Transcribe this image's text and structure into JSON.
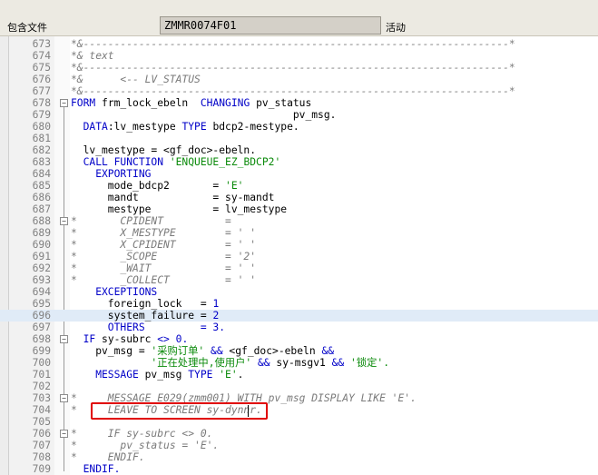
{
  "toolbar": {
    "include_label": "包含文件",
    "program_name": "ZMMR0074F01",
    "status": "活动"
  },
  "editor": {
    "current_line": 23,
    "lines": [
      {
        "n": "673",
        "fold": false,
        "parts": [
          [
            "cm",
            "*&---------------------------------------------------------------------*"
          ]
        ]
      },
      {
        "n": "674",
        "fold": false,
        "parts": [
          [
            "cm",
            "*& text"
          ]
        ]
      },
      {
        "n": "675",
        "fold": false,
        "parts": [
          [
            "cm",
            "*&---------------------------------------------------------------------*"
          ]
        ]
      },
      {
        "n": "676",
        "fold": false,
        "parts": [
          [
            "cm",
            "*&      <-- LV_STATUS"
          ]
        ]
      },
      {
        "n": "677",
        "fold": false,
        "parts": [
          [
            "cm",
            "*&---------------------------------------------------------------------*"
          ]
        ]
      },
      {
        "n": "678",
        "fold": true,
        "parts": [
          [
            "kw",
            "FORM "
          ],
          [
            "id",
            "frm_lock_ebeln  "
          ],
          [
            "kw",
            "CHANGING "
          ],
          [
            "id",
            "pv_status"
          ]
        ]
      },
      {
        "n": "679",
        "fold": false,
        "parts": [
          [
            "id",
            "                                    pv_msg."
          ]
        ]
      },
      {
        "n": "680",
        "fold": false,
        "parts": [
          [
            "kw",
            "  DATA"
          ],
          [
            "id",
            ":lv_mestype "
          ],
          [
            "kw",
            "TYPE "
          ],
          [
            "id",
            "bdcp2-mestype."
          ]
        ]
      },
      {
        "n": "681",
        "fold": false,
        "parts": [
          [
            "id",
            ""
          ]
        ]
      },
      {
        "n": "682",
        "fold": false,
        "parts": [
          [
            "id",
            "  lv_mestype = <gf_doc>-ebeln."
          ]
        ]
      },
      {
        "n": "683",
        "fold": false,
        "parts": [
          [
            "kw",
            "  CALL FUNCTION "
          ],
          [
            "st",
            "'ENQUEUE_EZ_BDCP2'"
          ]
        ]
      },
      {
        "n": "684",
        "fold": false,
        "parts": [
          [
            "kw",
            "    EXPORTING"
          ]
        ]
      },
      {
        "n": "685",
        "fold": false,
        "parts": [
          [
            "id",
            "      mode_bdcp2       = "
          ],
          [
            "st",
            "'E'"
          ]
        ]
      },
      {
        "n": "686",
        "fold": false,
        "parts": [
          [
            "id",
            "      mandt            = sy-mandt"
          ]
        ]
      },
      {
        "n": "687",
        "fold": false,
        "parts": [
          [
            "id",
            "      mestype          = lv_mestype"
          ]
        ]
      },
      {
        "n": "688",
        "fold": true,
        "parts": [
          [
            "cm",
            "*       CPIDENT          ="
          ]
        ]
      },
      {
        "n": "689",
        "fold": false,
        "parts": [
          [
            "cm",
            "*       X_MESTYPE        = ' '"
          ]
        ]
      },
      {
        "n": "690",
        "fold": false,
        "parts": [
          [
            "cm",
            "*       X_CPIDENT        = ' '"
          ]
        ]
      },
      {
        "n": "691",
        "fold": false,
        "parts": [
          [
            "cm",
            "*       _SCOPE           = '2'"
          ]
        ]
      },
      {
        "n": "692",
        "fold": false,
        "parts": [
          [
            "cm",
            "*       _WAIT            = ' '"
          ]
        ]
      },
      {
        "n": "693",
        "fold": false,
        "parts": [
          [
            "cm",
            "*       _COLLECT         = ' '"
          ]
        ]
      },
      {
        "n": "694",
        "fold": false,
        "parts": [
          [
            "kw",
            "    EXCEPTIONS"
          ]
        ]
      },
      {
        "n": "695",
        "fold": false,
        "parts": [
          [
            "id",
            "      foreign_lock   = "
          ],
          [
            "kw",
            "1"
          ]
        ]
      },
      {
        "n": "696",
        "fold": false,
        "parts": [
          [
            "id",
            "      system_failure = "
          ],
          [
            "kw",
            "2"
          ]
        ]
      },
      {
        "n": "697",
        "fold": false,
        "parts": [
          [
            "kw",
            "      OTHERS         = 3."
          ]
        ]
      },
      {
        "n": "698",
        "fold": true,
        "parts": [
          [
            "kw",
            "  IF "
          ],
          [
            "id",
            "sy-subrc "
          ],
          [
            "kw",
            "<> 0."
          ]
        ]
      },
      {
        "n": "699",
        "fold": false,
        "parts": [
          [
            "id",
            "    pv_msg = "
          ],
          [
            "st",
            "'采购订单' "
          ],
          [
            "kw",
            "&& "
          ],
          [
            "id",
            "<gf_doc>-ebeln "
          ],
          [
            "kw",
            "&&"
          ]
        ]
      },
      {
        "n": "700",
        "fold": false,
        "parts": [
          [
            "st",
            "             '正在处理中,使用户' "
          ],
          [
            "kw",
            "&& "
          ],
          [
            "id",
            "sy-msgv1 "
          ],
          [
            "kw",
            "&& "
          ],
          [
            "st",
            "'锁定'."
          ]
        ]
      },
      {
        "n": "701",
        "fold": false,
        "parts": [
          [
            "kw",
            "    MESSAGE "
          ],
          [
            "id",
            "pv_msg "
          ],
          [
            "kw",
            "TYPE "
          ],
          [
            "st",
            "'E'"
          ],
          [
            "id",
            "."
          ]
        ]
      },
      {
        "n": "702",
        "fold": false,
        "parts": [
          [
            "id",
            ""
          ]
        ]
      },
      {
        "n": "703",
        "fold": true,
        "parts": [
          [
            "cm",
            "*     MESSAGE E029(zmm001) WITH pv_msg DISPLAY LIKE 'E'."
          ]
        ]
      },
      {
        "n": "704",
        "fold": false,
        "parts": [
          [
            "cm",
            "*     LEAVE TO SCREEN sy-dynnr."
          ]
        ]
      },
      {
        "n": "705",
        "fold": false,
        "parts": [
          [
            "id",
            ""
          ]
        ]
      },
      {
        "n": "706",
        "fold": true,
        "parts": [
          [
            "cm",
            "*     IF sy-subrc <> 0."
          ]
        ]
      },
      {
        "n": "707",
        "fold": false,
        "parts": [
          [
            "cm",
            "*       pv_status = 'E'."
          ]
        ]
      },
      {
        "n": "708",
        "fold": false,
        "parts": [
          [
            "cm",
            "*     ENDIF."
          ]
        ]
      },
      {
        "n": "709",
        "fold": false,
        "parts": [
          [
            "kw",
            "  ENDIF."
          ]
        ]
      }
    ]
  }
}
